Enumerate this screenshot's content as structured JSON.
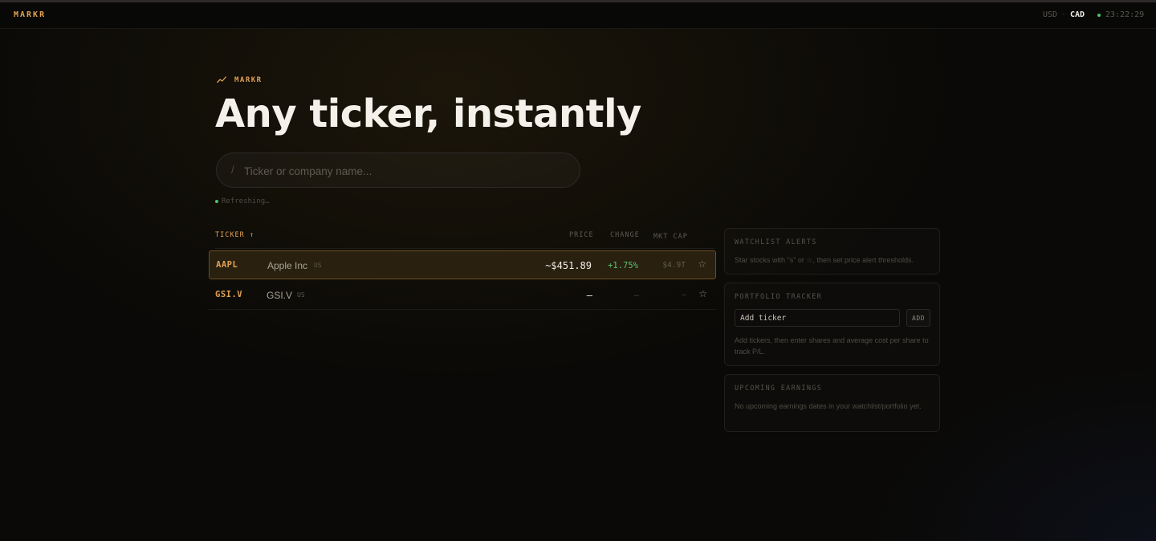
{
  "topbar": {
    "brand": "MARKR",
    "currencies": [
      "USD",
      "CAD"
    ],
    "currency_separator": "·",
    "active_currency": "CAD",
    "clock": "23:22:29"
  },
  "hero": {
    "eyebrow": "MARKR",
    "eyebrow_icon": "trend-line-icon",
    "title": "Any ticker, instantly",
    "search_prefix": "/",
    "search_placeholder": "Ticker or company name...",
    "status": "Refreshing…"
  },
  "table": {
    "headers": {
      "ticker": "TICKER ↑",
      "price": "PRICE",
      "change": "CHANGE",
      "mktcap": "MKT CAP"
    },
    "rows": [
      {
        "ticker": "AAPL",
        "name": "Apple Inc",
        "exchange": "US",
        "price": "~$451.89",
        "change": "+1.75%",
        "mktcap": "$4.9T",
        "star": "☆",
        "highlighted": true
      },
      {
        "ticker": "GSI.V",
        "name": "GSI.V",
        "exchange": "US",
        "price": "—",
        "change": "—",
        "mktcap": "—",
        "star": "☆",
        "highlighted": false
      }
    ]
  },
  "sidebar": {
    "watchlist": {
      "title": "WATCHLIST ALERTS",
      "text": "Star stocks with \"s\" or ☆, then set price alert thresholds."
    },
    "portfolio": {
      "title": "PORTFOLIO TRACKER",
      "input_placeholder": "Add ticker",
      "add_label": "ADD",
      "text": "Add tickers, then enter shares and average cost per share to track P/L."
    },
    "earnings": {
      "title": "UPCOMING EARNINGS",
      "text": "No upcoming earnings dates in your watchlist/portfolio yet."
    }
  },
  "colors": {
    "accent": "#e0a155",
    "positive": "#58c276",
    "status_dot": "#4ec36a",
    "background": "#0a0907"
  }
}
